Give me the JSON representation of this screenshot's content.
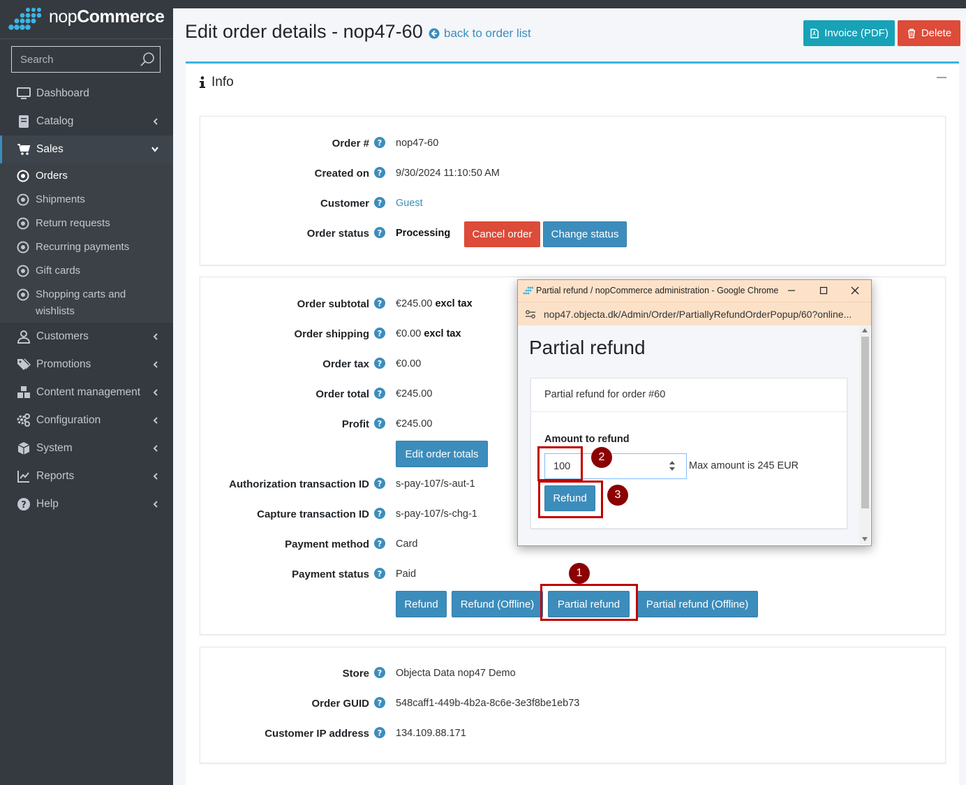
{
  "brand": {
    "name_light": "nop",
    "name_bold": "Commerce"
  },
  "search": {
    "placeholder": "Search"
  },
  "sidebar": {
    "items": [
      {
        "label": "Dashboard",
        "icon": "dashboard-icon"
      },
      {
        "label": "Catalog",
        "icon": "book-icon"
      },
      {
        "label": "Sales",
        "icon": "cart-icon"
      },
      {
        "label": "Customers",
        "icon": "user-icon"
      },
      {
        "label": "Promotions",
        "icon": "tags-icon"
      },
      {
        "label": "Content management",
        "icon": "cubes-icon"
      },
      {
        "label": "Configuration",
        "icon": "gears-icon"
      },
      {
        "label": "System",
        "icon": "cube-icon"
      },
      {
        "label": "Reports",
        "icon": "chart-icon"
      },
      {
        "label": "Help",
        "icon": "question-icon"
      }
    ],
    "sales_sub": [
      {
        "label": "Orders"
      },
      {
        "label": "Shipments"
      },
      {
        "label": "Return requests"
      },
      {
        "label": "Recurring payments"
      },
      {
        "label": "Gift cards"
      },
      {
        "label": "Shopping carts and wishlists"
      }
    ]
  },
  "header": {
    "title": "Edit order details - nop47-60",
    "back_link": "back to order list",
    "invoice_button": "Invoice (PDF)",
    "delete_button": "Delete"
  },
  "info_card": {
    "title": "Info"
  },
  "order": {
    "rows1": [
      {
        "label": "Order #",
        "value": "nop47-60"
      },
      {
        "label": "Created on",
        "value": "9/30/2024 11:10:50 AM"
      },
      {
        "label": "Customer",
        "value": "Guest"
      },
      {
        "label": "Order status",
        "value": "Processing"
      }
    ],
    "cancel_button": "Cancel order",
    "change_status_button": "Change status",
    "rows2": [
      {
        "label": "Order subtotal",
        "value": "€245.00",
        "suffix": "excl tax"
      },
      {
        "label": "Order shipping",
        "value": "€0.00",
        "suffix": "excl tax"
      },
      {
        "label": "Order tax",
        "value": "€0.00"
      },
      {
        "label": "Order total",
        "value": "€245.00"
      },
      {
        "label": "Profit",
        "value": "€245.00"
      },
      {
        "label": "Authorization transaction ID",
        "value": "s-pay-107/s-aut-1"
      },
      {
        "label": "Capture transaction ID",
        "value": "s-pay-107/s-chg-1"
      },
      {
        "label": "Payment method",
        "value": "Card"
      },
      {
        "label": "Payment status",
        "value": "Paid"
      }
    ],
    "edit_totals_button": "Edit order totals",
    "refund_button": "Refund",
    "refund_offline_button": "Refund (Offline)",
    "partial_refund_button": "Partial refund",
    "partial_refund_offline_button": "Partial refund (Offline)",
    "rows3": [
      {
        "label": "Store",
        "value": "Objecta Data nop47 Demo"
      },
      {
        "label": "Order GUID",
        "value": "548caff1-449b-4b2a-8c6e-3e3f8be1eb73"
      },
      {
        "label": "Customer IP address",
        "value": "134.109.88.171"
      }
    ]
  },
  "popup": {
    "window_title": "Partial refund / nopCommerce administration - Google Chrome",
    "url": "nop47.objecta.dk/Admin/Order/PartiallyRefundOrderPopup/60?online...",
    "heading": "Partial refund",
    "card_title": "Partial refund for order #60",
    "amount_label": "Amount to refund",
    "amount_value": "100",
    "max_text": "Max amount is 245 EUR",
    "refund_button": "Refund"
  },
  "annotations": [
    "1",
    "2",
    "3"
  ],
  "colors": {
    "primary": "#3c8dbc",
    "danger": "#dd4b39",
    "info": "#17a2b8",
    "sidebar": "#343a40",
    "mark": "#c00000"
  }
}
